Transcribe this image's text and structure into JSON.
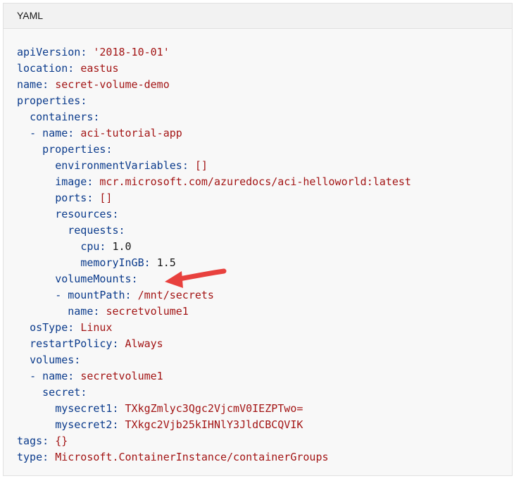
{
  "header": {
    "language": "YAML"
  },
  "lines": [
    {
      "indent": "",
      "dash": "",
      "key": "apiVersion",
      "value": "'2018-10-01'",
      "vclass": "v"
    },
    {
      "indent": "",
      "dash": "",
      "key": "location",
      "value": "eastus",
      "vclass": "v"
    },
    {
      "indent": "",
      "dash": "",
      "key": "name",
      "value": "secret-volume-demo",
      "vclass": "v"
    },
    {
      "indent": "",
      "dash": "",
      "key": "properties",
      "value": "",
      "vclass": "v"
    },
    {
      "indent": "  ",
      "dash": "",
      "key": "containers",
      "value": "",
      "vclass": "v"
    },
    {
      "indent": "  ",
      "dash": "- ",
      "key": "name",
      "value": "aci-tutorial-app",
      "vclass": "v"
    },
    {
      "indent": "    ",
      "dash": "",
      "key": "properties",
      "value": "",
      "vclass": "v"
    },
    {
      "indent": "      ",
      "dash": "",
      "key": "environmentVariables",
      "value": "[]",
      "vclass": "v"
    },
    {
      "indent": "      ",
      "dash": "",
      "key": "image",
      "value": "mcr.microsoft.com/azuredocs/aci-helloworld:latest",
      "vclass": "v"
    },
    {
      "indent": "      ",
      "dash": "",
      "key": "ports",
      "value": "[]",
      "vclass": "v"
    },
    {
      "indent": "      ",
      "dash": "",
      "key": "resources",
      "value": "",
      "vclass": "v"
    },
    {
      "indent": "        ",
      "dash": "",
      "key": "requests",
      "value": "",
      "vclass": "v"
    },
    {
      "indent": "          ",
      "dash": "",
      "key": "cpu",
      "value": "1.0",
      "vclass": "n"
    },
    {
      "indent": "          ",
      "dash": "",
      "key": "memoryInGB",
      "value": "1.5",
      "vclass": "n"
    },
    {
      "indent": "      ",
      "dash": "",
      "key": "volumeMounts",
      "value": "",
      "vclass": "v"
    },
    {
      "indent": "      ",
      "dash": "- ",
      "key": "mountPath",
      "value": "/mnt/secrets",
      "vclass": "v"
    },
    {
      "indent": "        ",
      "dash": "",
      "key": "name",
      "value": "secretvolume1",
      "vclass": "v"
    },
    {
      "indent": "  ",
      "dash": "",
      "key": "osType",
      "value": "Linux",
      "vclass": "v"
    },
    {
      "indent": "  ",
      "dash": "",
      "key": "restartPolicy",
      "value": "Always",
      "vclass": "v"
    },
    {
      "indent": "  ",
      "dash": "",
      "key": "volumes",
      "value": "",
      "vclass": "v"
    },
    {
      "indent": "  ",
      "dash": "- ",
      "key": "name",
      "value": "secretvolume1",
      "vclass": "v"
    },
    {
      "indent": "    ",
      "dash": "",
      "key": "secret",
      "value": "",
      "vclass": "v"
    },
    {
      "indent": "      ",
      "dash": "",
      "key": "mysecret1",
      "value": "TXkgZmlyc3Qgc2VjcmV0IEZPTwo=",
      "vclass": "v"
    },
    {
      "indent": "      ",
      "dash": "",
      "key": "mysecret2",
      "value": "TXkgc2Vjb25kIHNlY3JldCBCQVIK",
      "vclass": "v"
    },
    {
      "indent": "",
      "dash": "",
      "key": "tags",
      "value": "{}",
      "vclass": "v"
    },
    {
      "indent": "",
      "dash": "",
      "key": "type",
      "value": "Microsoft.ContainerInstance/containerGroups",
      "vclass": "v"
    }
  ],
  "colors": {
    "key": "#0b3b8c",
    "string_value": "#a31515",
    "number_value": "#171717",
    "arrow": "#e8413e",
    "background": "#f8f8f8"
  },
  "annotation": {
    "icon": "red-arrow-icon",
    "points_to_line": 14
  }
}
